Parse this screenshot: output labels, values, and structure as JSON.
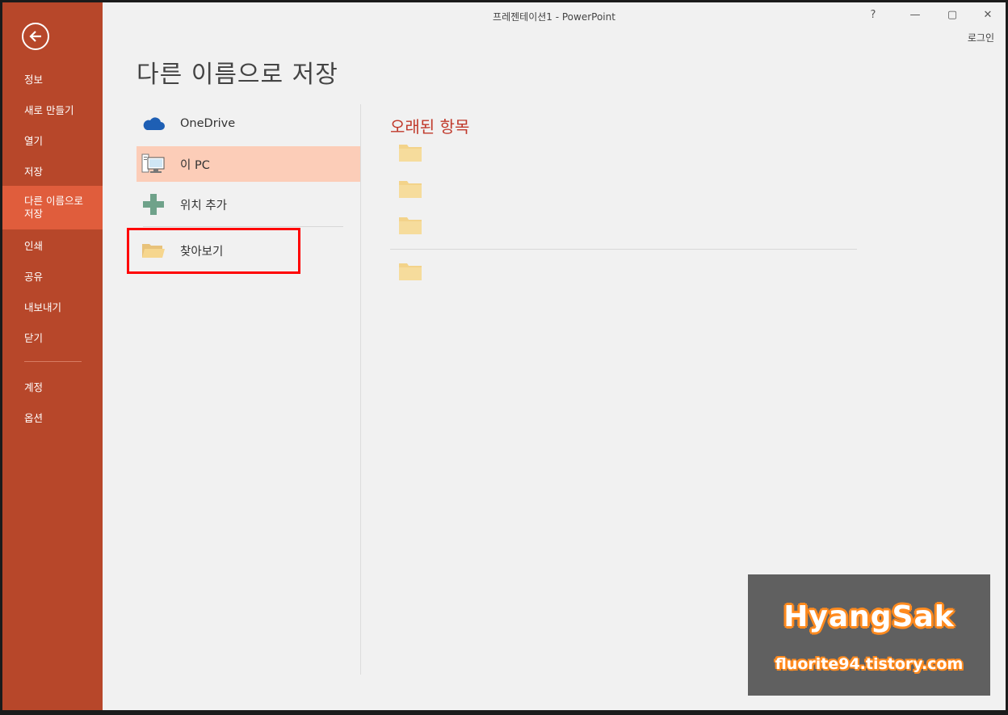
{
  "window": {
    "title": "프레젠테이션1 - PowerPoint",
    "help": "?",
    "minimize": "—",
    "maximize": "▢",
    "close": "✕",
    "login": "로그인"
  },
  "sidebar": {
    "items": [
      {
        "label": "정보"
      },
      {
        "label": "새로 만들기"
      },
      {
        "label": "열기"
      },
      {
        "label": "저장"
      },
      {
        "label": "다른 이름으로 저장",
        "active": true
      },
      {
        "label": "인쇄"
      },
      {
        "label": "공유"
      },
      {
        "label": "내보내기"
      },
      {
        "label": "닫기"
      }
    ],
    "bottom_items": [
      {
        "label": "계정"
      },
      {
        "label": "옵션"
      }
    ]
  },
  "main": {
    "heading": "다른 이름으로 저장",
    "places": [
      {
        "label": "OneDrive",
        "icon": "cloud-icon"
      },
      {
        "label": "이 PC",
        "icon": "computer-icon",
        "selected": true
      },
      {
        "label": "위치 추가",
        "icon": "plus-icon"
      }
    ],
    "browse": {
      "label": "찾아보기",
      "icon": "open-folder-icon"
    },
    "recent_title": "오래된 항목"
  },
  "watermark": {
    "title": "HyangSak",
    "url": "fluorite94.tistory.com"
  },
  "colors": {
    "sidebar": "#b7472a",
    "sidebar_active": "#e05d3c",
    "selected_place": "#fccdb8",
    "accent_text": "#c0392b",
    "highlight_box": "#ff0000"
  }
}
